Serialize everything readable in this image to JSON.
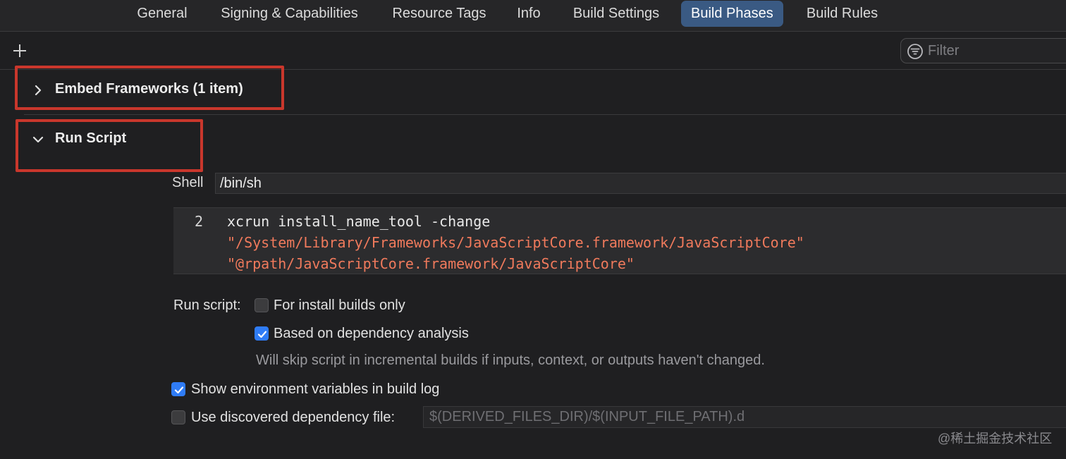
{
  "tabs": [
    {
      "label": "General",
      "active": false
    },
    {
      "label": "Signing & Capabilities",
      "active": false
    },
    {
      "label": "Resource Tags",
      "active": false
    },
    {
      "label": "Info",
      "active": false
    },
    {
      "label": "Build Settings",
      "active": false
    },
    {
      "label": "Build Phases",
      "active": true
    },
    {
      "label": "Build Rules",
      "active": false
    }
  ],
  "toolbar": {
    "add_icon": "plus-icon",
    "filter": {
      "placeholder": "Filter",
      "value": "",
      "icon": "filter-icon"
    }
  },
  "phases": {
    "embed_frameworks": {
      "title": "Embed Frameworks (1 item)",
      "expanded": false,
      "icon": "chevron-right-icon"
    },
    "run_script": {
      "title": "Run Script",
      "expanded": true,
      "icon": "chevron-down-icon"
    }
  },
  "run_script": {
    "shell_label": "Shell",
    "shell_value": "/bin/sh",
    "code": {
      "line_number": "2",
      "command": "xcrun install_name_tool -change",
      "arg1": "\"/System/Library/Frameworks/JavaScriptCore.framework/JavaScriptCore\"",
      "arg2": "\"@rpath/JavaScriptCore.framework/JavaScriptCore\""
    },
    "run_script_label": "Run script:",
    "install_builds_only": {
      "label": "For install builds only",
      "checked": false
    },
    "dependency_analysis": {
      "label": "Based on dependency analysis",
      "checked": true
    },
    "dependency_hint": "Will skip script in incremental builds if inputs, context, or outputs haven't changed.",
    "show_env_vars": {
      "label": "Show environment variables in build log",
      "checked": true
    },
    "discovered_dep_file": {
      "label": "Use discovered dependency file:",
      "checked": false,
      "placeholder": "$(DERIVED_FILES_DIR)/$(INPUT_FILE_PATH).d"
    }
  },
  "watermark": "@稀土掘金技术社区",
  "colors": {
    "background": "#1f1f21",
    "active_tab": "#3a5a83",
    "highlight": "#c9372c",
    "checkbox_checked": "#2f7cf6",
    "code_string": "#f07a5c"
  }
}
